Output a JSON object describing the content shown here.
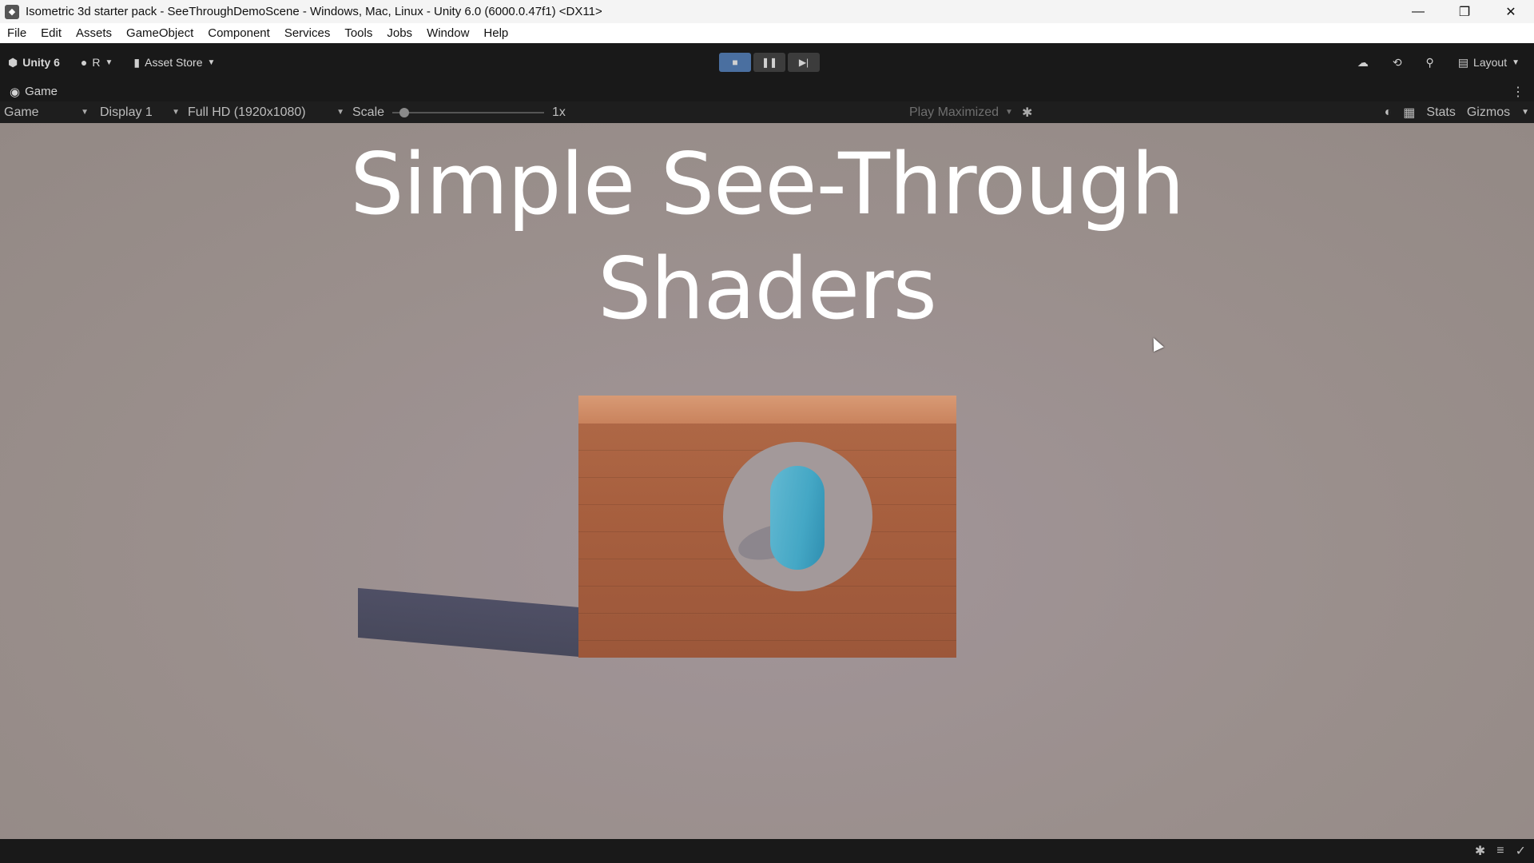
{
  "window": {
    "title": "Isometric 3d starter pack - SeeThroughDemoScene - Windows, Mac, Linux - Unity 6.0 (6000.0.47f1) <DX11>",
    "controls": {
      "minimize": "—",
      "restore": "❐",
      "close": "✕"
    }
  },
  "menu": [
    "File",
    "Edit",
    "Assets",
    "GameObject",
    "Component",
    "Services",
    "Tools",
    "Jobs",
    "Window",
    "Help"
  ],
  "toolbar": {
    "unity_label": "Unity 6",
    "account_label": "R",
    "asset_store_label": "Asset Store",
    "layout_label": "Layout",
    "play_buttons": {
      "stop": "■",
      "pause": "❚❚",
      "step": "▶|"
    }
  },
  "game_tab": {
    "label": "Game"
  },
  "game_bar": {
    "view_mode": "Game",
    "display": "Display 1",
    "resolution": "Full HD (1920x1080)",
    "scale_label": "Scale",
    "scale_value": "1x",
    "scale_level": 0.05,
    "play_mode": "Play Maximized",
    "stats_label": "Stats",
    "gizmos_label": "Gizmos"
  },
  "scene": {
    "headline_line1": "Simple See-Through",
    "headline_line2": "Shaders"
  },
  "colors": {
    "background": "#9a8f8c",
    "wood": "#a8603f",
    "capsule": "#44a7c5",
    "toolbar": "#191919"
  }
}
